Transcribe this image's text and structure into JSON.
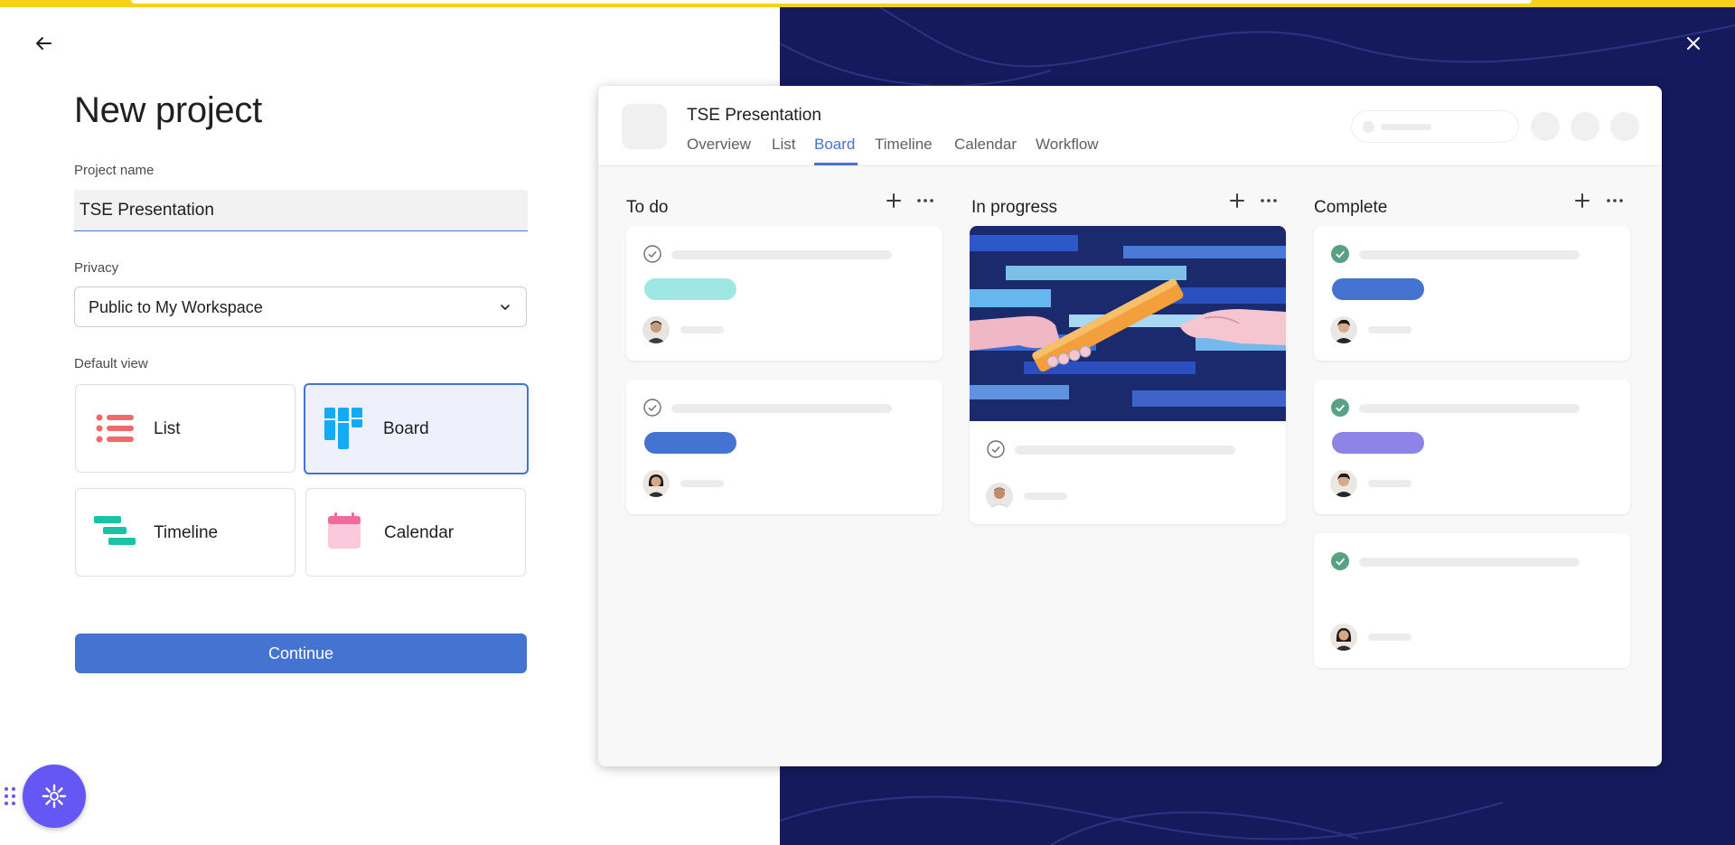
{
  "page": {
    "title": "New project",
    "back_icon": "arrow-left-icon",
    "close_icon": "close-icon"
  },
  "form": {
    "name_label": "Project name",
    "name_value": "TSE Presentation",
    "privacy_label": "Privacy",
    "privacy_value": "Public to My Workspace",
    "view_label": "Default view",
    "views": [
      {
        "label": "List",
        "icon": "list-icon",
        "selected": false
      },
      {
        "label": "Board",
        "icon": "board-icon",
        "selected": true
      },
      {
        "label": "Timeline",
        "icon": "timeline-icon",
        "selected": false
      },
      {
        "label": "Calendar",
        "icon": "calendar-icon",
        "selected": false
      }
    ],
    "continue_label": "Continue"
  },
  "preview": {
    "project_title": "TSE Presentation",
    "tabs": [
      "Overview",
      "List",
      "Board",
      "Timeline",
      "Calendar",
      "Workflow"
    ],
    "active_tab": "Board",
    "columns": [
      {
        "title": "To do"
      },
      {
        "title": "In progress"
      },
      {
        "title": "Complete"
      }
    ]
  },
  "colors": {
    "accent": "#4573d2",
    "dark_panel": "#141a5c",
    "top_bar": "#f6d21b",
    "assistant": "#6457f5",
    "pill_teal": "#9ee7e3",
    "pill_blue": "#4573d2",
    "pill_purple": "#8d84e8",
    "complete_check": "#58a182"
  }
}
